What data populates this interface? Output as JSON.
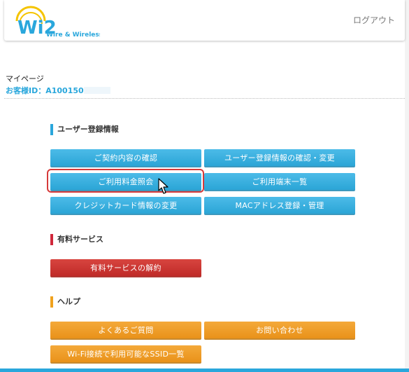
{
  "header": {
    "logo_mark": "Wi2",
    "logo_text": "Wire & Wireless",
    "logout_label": "ログアウト"
  },
  "account": {
    "page_title": "マイページ",
    "customer_id_label": "お客様ID：A100150"
  },
  "sections": {
    "user": {
      "title": "ユーザー登録情報",
      "buttons": {
        "contract": "ご契約内容の確認",
        "user_info": "ユーザー登録情報の確認・変更",
        "billing": "ご利用料金照会",
        "devices": "ご利用端末一覧",
        "credit_card": "クレジットカード情報の変更",
        "mac": "MACアドレス登録・管理"
      }
    },
    "paid": {
      "title": "有料サービス",
      "buttons": {
        "cancel": "有料サービスの解約"
      }
    },
    "help": {
      "title": "ヘルプ",
      "buttons": {
        "faq": "よくあるご質問",
        "contact": "お問い合わせ",
        "ssid": "Wi-Fi接続で利用可能なSSID一覧"
      }
    }
  },
  "colors": {
    "accent_blue": "#2aa7dc",
    "danger_red": "#c02a28",
    "help_orange": "#f0a21e",
    "highlight": "#d63a3a"
  }
}
